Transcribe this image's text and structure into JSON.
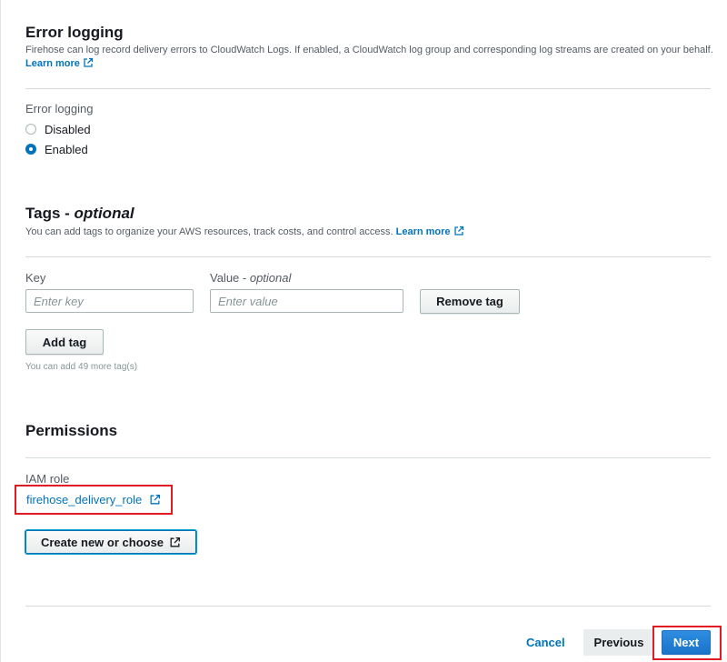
{
  "error_logging": {
    "title": "Error logging",
    "description": "Firehose can log record delivery errors to CloudWatch Logs. If enabled, a CloudWatch log group and corresponding log streams are created on your behalf.",
    "learn_more": "Learn more",
    "field_label": "Error logging",
    "options": [
      {
        "label": "Disabled",
        "selected": false
      },
      {
        "label": "Enabled",
        "selected": true
      }
    ]
  },
  "tags": {
    "title": "Tags - ",
    "title_optional": "optional",
    "description": "You can add tags to organize your AWS resources, track costs, and control access.",
    "learn_more": "Learn more",
    "key_label": "Key",
    "value_label": "Value - ",
    "value_optional": "optional",
    "key_placeholder": "Enter key",
    "value_placeholder": "Enter value",
    "remove_tag": "Remove tag",
    "add_tag": "Add tag",
    "remaining_hint": "You can add 49 more tag(s)"
  },
  "permissions": {
    "title": "Permissions",
    "iam_role_label": "IAM role",
    "role_name": "firehose_delivery_role",
    "create_button": "Create new or choose"
  },
  "footer": {
    "cancel": "Cancel",
    "previous": "Previous",
    "next": "Next"
  },
  "colors": {
    "link": "#0073bb",
    "highlight": "#e01b24",
    "primary": "#2e8ee0"
  },
  "icons": [
    "external-link-icon"
  ]
}
